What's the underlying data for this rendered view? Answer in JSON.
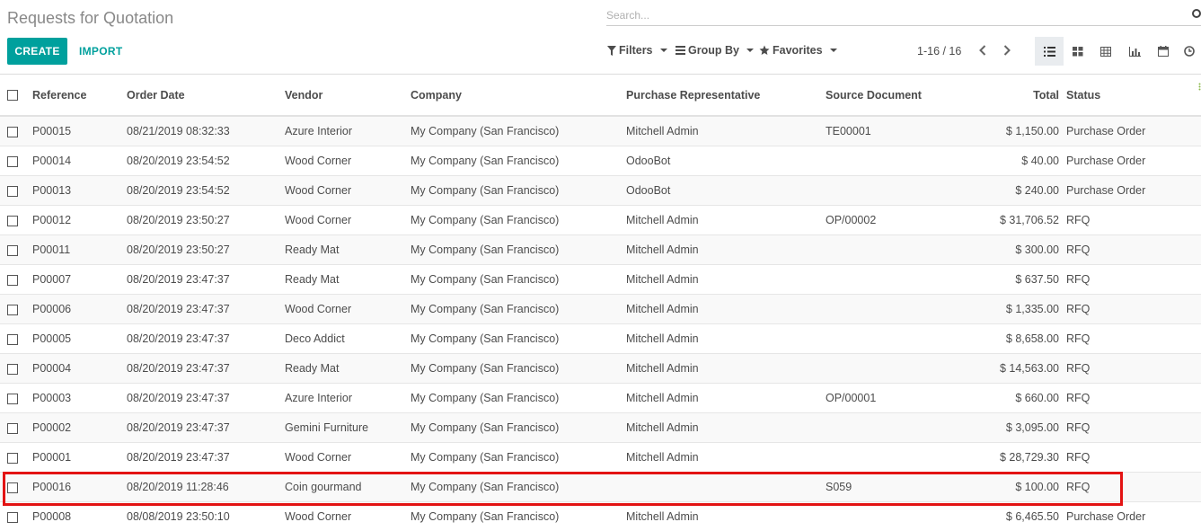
{
  "page": {
    "title": "Requests for Quotation",
    "search_placeholder": "Search..."
  },
  "toolbar": {
    "create_label": "CREATE",
    "import_label": "IMPORT",
    "filters_label": "Filters",
    "groupby_label": "Group By",
    "favorites_label": "Favorites",
    "pager_value": "1-16 / 16"
  },
  "views": [
    "list-view",
    "kanban-view",
    "pivot-view",
    "graph-view",
    "calendar-view",
    "activity-view"
  ],
  "columns": [
    "Reference",
    "Order Date",
    "Vendor",
    "Company",
    "Purchase Representative",
    "Source Document",
    "Total",
    "Status"
  ],
  "rows": [
    {
      "ref": "P00015",
      "date": "08/21/2019 08:32:33",
      "vendor": "Azure Interior",
      "company": "My Company (San Francisco)",
      "rep": "Mitchell Admin",
      "source": "TE00001",
      "total": "$ 1,150.00",
      "status": "Purchase Order"
    },
    {
      "ref": "P00014",
      "date": "08/20/2019 23:54:52",
      "vendor": "Wood Corner",
      "company": "My Company (San Francisco)",
      "rep": "OdooBot",
      "source": "",
      "total": "$ 40.00",
      "status": "Purchase Order"
    },
    {
      "ref": "P00013",
      "date": "08/20/2019 23:54:52",
      "vendor": "Wood Corner",
      "company": "My Company (San Francisco)",
      "rep": "OdooBot",
      "source": "",
      "total": "$ 240.00",
      "status": "Purchase Order"
    },
    {
      "ref": "P00012",
      "date": "08/20/2019 23:50:27",
      "vendor": "Wood Corner",
      "company": "My Company (San Francisco)",
      "rep": "Mitchell Admin",
      "source": "OP/00002",
      "total": "$ 31,706.52",
      "status": "RFQ"
    },
    {
      "ref": "P00011",
      "date": "08/20/2019 23:50:27",
      "vendor": "Ready Mat",
      "company": "My Company (San Francisco)",
      "rep": "Mitchell Admin",
      "source": "",
      "total": "$ 300.00",
      "status": "RFQ"
    },
    {
      "ref": "P00007",
      "date": "08/20/2019 23:47:37",
      "vendor": "Ready Mat",
      "company": "My Company (San Francisco)",
      "rep": "Mitchell Admin",
      "source": "",
      "total": "$ 637.50",
      "status": "RFQ"
    },
    {
      "ref": "P00006",
      "date": "08/20/2019 23:47:37",
      "vendor": "Wood Corner",
      "company": "My Company (San Francisco)",
      "rep": "Mitchell Admin",
      "source": "",
      "total": "$ 1,335.00",
      "status": "RFQ"
    },
    {
      "ref": "P00005",
      "date": "08/20/2019 23:47:37",
      "vendor": "Deco Addict",
      "company": "My Company (San Francisco)",
      "rep": "Mitchell Admin",
      "source": "",
      "total": "$ 8,658.00",
      "status": "RFQ"
    },
    {
      "ref": "P00004",
      "date": "08/20/2019 23:47:37",
      "vendor": "Ready Mat",
      "company": "My Company (San Francisco)",
      "rep": "Mitchell Admin",
      "source": "",
      "total": "$ 14,563.00",
      "status": "RFQ"
    },
    {
      "ref": "P00003",
      "date": "08/20/2019 23:47:37",
      "vendor": "Azure Interior",
      "company": "My Company (San Francisco)",
      "rep": "Mitchell Admin",
      "source": "OP/00001",
      "total": "$ 660.00",
      "status": "RFQ"
    },
    {
      "ref": "P00002",
      "date": "08/20/2019 23:47:37",
      "vendor": "Gemini Furniture",
      "company": "My Company (San Francisco)",
      "rep": "Mitchell Admin",
      "source": "",
      "total": "$ 3,095.00",
      "status": "RFQ"
    },
    {
      "ref": "P00001",
      "date": "08/20/2019 23:47:37",
      "vendor": "Wood Corner",
      "company": "My Company (San Francisco)",
      "rep": "Mitchell Admin",
      "source": "",
      "total": "$ 28,729.30",
      "status": "RFQ"
    },
    {
      "ref": "P00016",
      "date": "08/20/2019 11:28:46",
      "vendor": "Coin gourmand",
      "company": "My Company (San Francisco)",
      "rep": "",
      "source": "S059",
      "total": "$ 100.00",
      "status": "RFQ"
    },
    {
      "ref": "P00008",
      "date": "08/08/2019 23:50:10",
      "vendor": "Wood Corner",
      "company": "My Company (San Francisco)",
      "rep": "Mitchell Admin",
      "source": "",
      "total": "$ 6,465.50",
      "status": "Purchase Order"
    }
  ],
  "colors": {
    "accent": "#00a09d",
    "highlight": "#e31313"
  }
}
